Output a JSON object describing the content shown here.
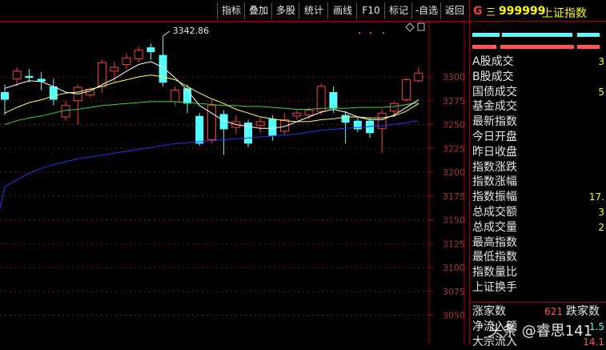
{
  "toolbar": {
    "buttons": [
      "指标",
      "叠加",
      "多股",
      "统计",
      "画线",
      "F10",
      "标记",
      "-自选",
      "返回"
    ]
  },
  "chart": {
    "high_label": "3342.86",
    "y_ticks": [
      3300,
      3275,
      3250,
      3225,
      3200,
      3175,
      3150,
      3125,
      3100,
      3075,
      3050
    ],
    "colors": {
      "up": "#ff3c3c",
      "down": "#54ffff",
      "ma5": "#ffffff",
      "ma10": "#ffff44",
      "ma20": "#33dd33",
      "ma60": "#2233ff"
    }
  },
  "chart_data": {
    "type": "candlestick",
    "y_axis_ticks": [
      3300,
      3275,
      3250,
      3225,
      3200,
      3175,
      3150,
      3125,
      3100,
      3075,
      3050
    ],
    "annotations": [
      "3342.86"
    ],
    "candles": [
      {
        "o": 3284,
        "c": 3276,
        "h": 3292,
        "l": 3260
      },
      {
        "o": 3298,
        "c": 3306,
        "h": 3310,
        "l": 3290
      },
      {
        "o": 3301,
        "c": 3299,
        "h": 3308,
        "l": 3294
      },
      {
        "o": 3298,
        "c": 3295,
        "h": 3305,
        "l": 3286
      },
      {
        "o": 3290,
        "c": 3276,
        "h": 3298,
        "l": 3270
      },
      {
        "o": 3258,
        "c": 3270,
        "h": 3275,
        "l": 3254
      },
      {
        "o": 3275,
        "c": 3289,
        "h": 3292,
        "l": 3250
      },
      {
        "o": 3281,
        "c": 3287,
        "h": 3289,
        "l": 3279
      },
      {
        "o": 3290,
        "c": 3315,
        "h": 3318,
        "l": 3283
      },
      {
        "o": 3306,
        "c": 3310,
        "h": 3316,
        "l": 3295
      },
      {
        "o": 3313,
        "c": 3320,
        "h": 3325,
        "l": 3308
      },
      {
        "o": 3319,
        "c": 3328,
        "h": 3332,
        "l": 3315
      },
      {
        "o": 3331,
        "c": 3326,
        "h": 3335,
        "l": 3318
      },
      {
        "o": 3323,
        "c": 3294,
        "h": 3342.86,
        "l": 3290
      },
      {
        "o": 3274,
        "c": 3286,
        "h": 3290,
        "l": 3270
      },
      {
        "o": 3288,
        "c": 3272,
        "h": 3292,
        "l": 3262
      },
      {
        "o": 3259,
        "c": 3230,
        "h": 3262,
        "l": 3228
      },
      {
        "o": 3234,
        "c": 3270,
        "h": 3276,
        "l": 3230
      },
      {
        "o": 3261,
        "c": 3245,
        "h": 3265,
        "l": 3218
      },
      {
        "o": 3247,
        "c": 3253,
        "h": 3260,
        "l": 3240
      },
      {
        "o": 3252,
        "c": 3230,
        "h": 3255,
        "l": 3226
      },
      {
        "o": 3249,
        "c": 3253,
        "h": 3257,
        "l": 3241
      },
      {
        "o": 3256,
        "c": 3238,
        "h": 3260,
        "l": 3233
      },
      {
        "o": 3243,
        "c": 3255,
        "h": 3262,
        "l": 3240
      },
      {
        "o": 3259,
        "c": 3262,
        "h": 3265,
        "l": 3255
      },
      {
        "o": 3260,
        "c": 3265,
        "h": 3268,
        "l": 3256
      },
      {
        "o": 3264,
        "c": 3290,
        "h": 3293,
        "l": 3260
      },
      {
        "o": 3284,
        "c": 3267,
        "h": 3290,
        "l": 3262
      },
      {
        "o": 3260,
        "c": 3252,
        "h": 3264,
        "l": 3230
      },
      {
        "o": 3254,
        "c": 3245,
        "h": 3258,
        "l": 3242
      },
      {
        "o": 3254,
        "c": 3241,
        "h": 3257,
        "l": 3236
      },
      {
        "o": 3246,
        "c": 3262,
        "h": 3266,
        "l": 3220
      },
      {
        "o": 3264,
        "c": 3272,
        "h": 3274,
        "l": 3258
      },
      {
        "o": 3276,
        "c": 3297,
        "h": 3299,
        "l": 3274
      },
      {
        "o": 3296,
        "c": 3304,
        "h": 3310,
        "l": 3294
      }
    ],
    "ma_lines": {
      "ma5": [
        3288,
        3292,
        3296,
        3295,
        3290,
        3284,
        3282,
        3285,
        3292,
        3298,
        3306,
        3313,
        3316,
        3310,
        3299,
        3286,
        3270,
        3262,
        3254,
        3250,
        3248,
        3246,
        3246,
        3248,
        3253,
        3258,
        3263,
        3266,
        3263,
        3258,
        3255,
        3255,
        3260,
        3268,
        3276
      ],
      "ma10": [
        3262,
        3268,
        3273,
        3276,
        3280,
        3283,
        3284,
        3287,
        3290,
        3294,
        3297,
        3300,
        3302,
        3300,
        3297,
        3290,
        3283,
        3277,
        3272,
        3266,
        3262,
        3258,
        3256,
        3254,
        3253,
        3253,
        3255,
        3256,
        3258,
        3258,
        3257,
        3257,
        3259,
        3264,
        3272
      ],
      "ma20": [
        3250,
        3254,
        3257,
        3259,
        3262,
        3265,
        3266,
        3268,
        3270,
        3271,
        3272,
        3273,
        3274,
        3274,
        3274,
        3273,
        3272,
        3271,
        3270,
        3270,
        3269,
        3269,
        3268,
        3267,
        3266,
        3266,
        3267,
        3267,
        3267,
        3268,
        3268,
        3268,
        3269,
        3271,
        3273
      ],
      "ma60": [
        3185,
        3192,
        3199,
        3204,
        3208,
        3211,
        3214,
        3216,
        3218,
        3220,
        3222,
        3224,
        3226,
        3228,
        3230,
        3231,
        3232,
        3233,
        3234,
        3235,
        3236,
        3237,
        3238,
        3239,
        3240,
        3242,
        3244,
        3245,
        3246,
        3247,
        3248,
        3249,
        3250,
        3252,
        3254
      ]
    }
  },
  "panel": {
    "prefix_g": "G",
    "menu_icon": "三",
    "code": "999999",
    "name": "上证指数",
    "rows": [
      {
        "label": "A股成交",
        "value": "3"
      },
      {
        "label": "B股成交",
        "value": ""
      },
      {
        "label": "国债成交",
        "value": "5"
      },
      {
        "label": "基金成交",
        "value": ""
      },
      {
        "label": "最新指数",
        "value": ""
      },
      {
        "label": "今日开盘",
        "value": ""
      },
      {
        "label": "昨日收盘",
        "value": ""
      },
      {
        "label": "指数涨跌",
        "value": ""
      },
      {
        "label": "指数涨幅",
        "value": ""
      },
      {
        "label": "指数振幅",
        "value": "17."
      },
      {
        "label": "总成交额",
        "value": "3"
      },
      {
        "label": "总成交量",
        "value": "2"
      },
      {
        "label": "最高指数",
        "value": ""
      },
      {
        "label": "最低指数",
        "value": ""
      },
      {
        "label": "指数量比",
        "value": ""
      },
      {
        "label": "上证换手",
        "value": ""
      }
    ],
    "rise_label": "涨家数",
    "rise_value": "621",
    "fall_label": "跌家数",
    "net_inflow_label": "净流入额",
    "net_inflow_value": "1.5",
    "big_order_label": "大宗流入",
    "big_order_value": "14.1"
  },
  "watermark": "头条 @睿思141"
}
